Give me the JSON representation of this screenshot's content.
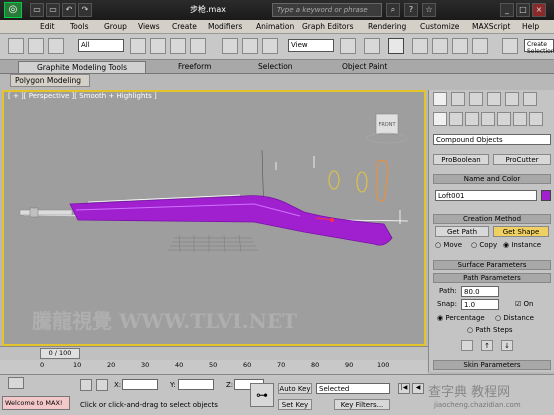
{
  "title": {
    "filename": "步枪.max",
    "search_placeholder": "Type a keyword or phrase"
  },
  "menu": [
    "Edit",
    "Tools",
    "Group",
    "Views",
    "Create",
    "Modifiers",
    "Animation",
    "Graph Editors",
    "Rendering",
    "Customize",
    "MAXScript",
    "Help"
  ],
  "toolbar": {
    "filter_select": "All",
    "coord_select": "View",
    "create_sel_label": "Create Selection"
  },
  "ribbon": {
    "tabs": [
      "Graphite Modeling Tools",
      "Freeform",
      "Selection",
      "Object Paint"
    ],
    "sub_tab": "Polygon Modeling"
  },
  "viewport": {
    "label": "[ + ][ Perspective ][ Smooth + Highlights ]",
    "viewcube_face": "FRONT",
    "watermark": "騰龍視覺 WWW.TLVI.NET"
  },
  "command_panel": {
    "category": "Compound Objects",
    "buttons_row1": [
      "ProBoolean",
      "ProCutter"
    ],
    "name_color_header": "Name and Color",
    "object_name": "Loft001",
    "object_color": "#a020d0",
    "creation_method_header": "Creation Method",
    "get_path": "Get Path",
    "get_shape": "Get Shape",
    "radios": [
      "Move",
      "Copy",
      "Instance"
    ],
    "surface_params": "Surface Parameters",
    "path_params": "Path Parameters",
    "path_label": "Path:",
    "path_value": "80.0",
    "snap_label": "Snap:",
    "snap_value": "1.0",
    "on_label": "On",
    "percentage": "Percentage",
    "distance": "Distance",
    "path_steps": "Path Steps",
    "skin_params": "Skin Parameters"
  },
  "timeline": {
    "counter": "0 / 100",
    "ticks": [
      "0",
      "10",
      "20",
      "30",
      "40",
      "50",
      "60",
      "70",
      "80",
      "90",
      "100"
    ]
  },
  "status": {
    "maxscript": "Welcome to MAX!",
    "prompt": "Click or click-and-drag to select objects",
    "x_label": "X:",
    "y_label": "Y:",
    "z_label": "Z:",
    "auto_key": "Auto Key",
    "set_key": "Set Key",
    "selected": "Selected",
    "key_filters": "Key Filters..."
  },
  "corner_watermark": "查字典 教程网",
  "corner_url": "jiaocheng.chazidian.com"
}
